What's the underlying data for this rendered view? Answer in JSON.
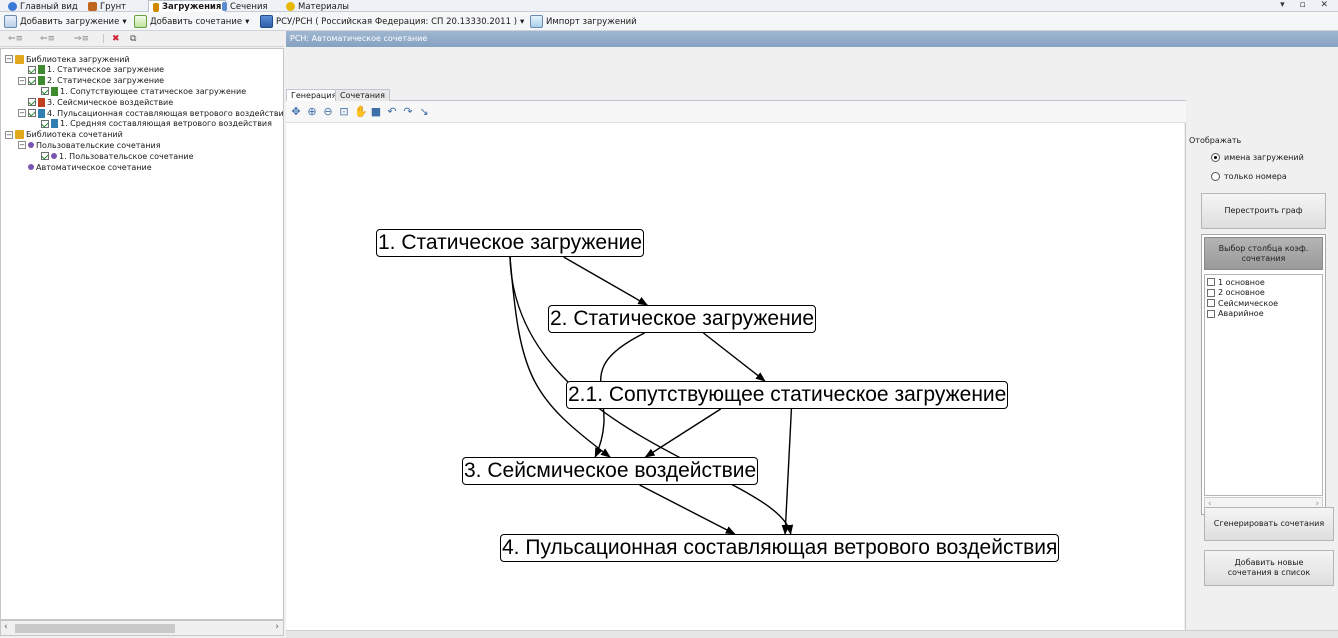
{
  "tabs": [
    {
      "label": "Главный вид",
      "icon": "home-icon",
      "color": "#3a7bd5"
    },
    {
      "label": "Грунт",
      "icon": "soil-icon",
      "color": "#c0641e"
    },
    {
      "label": "Загружения",
      "icon": "loads-icon",
      "color": "#d08a00",
      "active": true
    },
    {
      "label": "Сечения",
      "icon": "section-icon",
      "color": "#5b8ccf"
    },
    {
      "label": "Материалы",
      "icon": "materials-icon",
      "color": "#e6b800"
    }
  ],
  "window_controls": "▾ ▫ ✕",
  "toolbar": {
    "add_load": "Добавить загружение",
    "add_combination": "Добавить сочетание",
    "norm": "РСУ/РСН ( Российская Федерация: СП 20.13330.2011 )",
    "import_loads": "Импорт загружений",
    "dropdown_glyph": "▾"
  },
  "tree": {
    "nodes": [
      {
        "label": "Библиотека загружений",
        "level": 0,
        "toggle": "−",
        "checkbox": false,
        "icon": "folder-icon"
      },
      {
        "label": "1. Статическое загружение",
        "level": 1,
        "toggle": "",
        "checkbox": true,
        "icon": "static-load-icon"
      },
      {
        "label": "2. Статическое загружение",
        "level": 1,
        "toggle": "−",
        "checkbox": true,
        "icon": "static-load-icon"
      },
      {
        "label": "1. Сопутствующее статическое загружение",
        "level": 2,
        "toggle": "",
        "checkbox": true,
        "icon": "static-load-icon"
      },
      {
        "label": "3. Сейсмическое воздействие",
        "level": 1,
        "toggle": "",
        "checkbox": true,
        "icon": "seismic-icon"
      },
      {
        "label": "4. Пульсационная составляющая ветрового воздействи",
        "level": 1,
        "toggle": "−",
        "checkbox": true,
        "icon": "wind-icon"
      },
      {
        "label": "1. Средняя составляющая ветрового воздействия",
        "level": 2,
        "toggle": "",
        "checkbox": true,
        "icon": "wind-icon"
      },
      {
        "label": "Библиотека сочетаний",
        "level": 0,
        "toggle": "−",
        "checkbox": false,
        "icon": "folder-icon"
      },
      {
        "label": "Пользовательские сочетания",
        "level": 1,
        "toggle": "−",
        "checkbox": false,
        "icon": "combination-icon"
      },
      {
        "label": "1. Пользовательское сочетание",
        "level": 2,
        "toggle": "",
        "checkbox": true,
        "icon": "combination-icon"
      },
      {
        "label": "Автоматическое сочетание",
        "level": 1,
        "toggle": "",
        "checkbox": false,
        "icon": "combination-icon"
      }
    ]
  },
  "panel_header": "РСН: Автоматическое сочетание",
  "inner_tabs": [
    {
      "label": "Генерация",
      "active": true
    },
    {
      "label": "Сочетания",
      "active": false
    }
  ],
  "graph_toolbar": [
    {
      "name": "pan-icon",
      "glyph": "✥"
    },
    {
      "name": "zoom-in-icon",
      "glyph": "⊕"
    },
    {
      "name": "zoom-out-icon",
      "glyph": "⊖"
    },
    {
      "name": "zoom-fit-icon",
      "glyph": "⊡"
    },
    {
      "name": "hand-icon",
      "glyph": "✋"
    },
    {
      "name": "save-icon",
      "glyph": "■"
    },
    {
      "name": "undo-icon",
      "glyph": "↶"
    },
    {
      "name": "redo-icon",
      "glyph": "↷"
    },
    {
      "name": "pointer-icon",
      "glyph": "↘"
    }
  ],
  "graph": {
    "nodes": [
      {
        "id": "n1",
        "label": "1. Статическое загружение"
      },
      {
        "id": "n2",
        "label": "2. Статическое загружение"
      },
      {
        "id": "n21",
        "label": "2.1. Сопутствующее статическое загружение"
      },
      {
        "id": "n3",
        "label": "3. Сейсмическое воздействие"
      },
      {
        "id": "n4",
        "label": "4. Пульсационная составляющая ветрового воздействия"
      }
    ],
    "edges": [
      [
        "n1",
        "n2"
      ],
      [
        "n1",
        "n3"
      ],
      [
        "n1",
        "n4"
      ],
      [
        "n2",
        "n21"
      ],
      [
        "n2",
        "n3"
      ],
      [
        "n21",
        "n3"
      ],
      [
        "n21",
        "n4"
      ],
      [
        "n3",
        "n4"
      ]
    ]
  },
  "sidebar": {
    "display_label": "Отображать",
    "radio_names": "имена загружений",
    "radio_numbers": "только номера",
    "selected": "names",
    "rebuild_button": "Перестроить граф",
    "column_header": "Выбор столбца коэф. сочетания",
    "columns": [
      "1 основное",
      "2 основное",
      "Сейсмическое",
      "Аварийное"
    ],
    "generate_button": "Сгенерировать сочетания",
    "add_button": "Добавить новые сочетания в список"
  }
}
